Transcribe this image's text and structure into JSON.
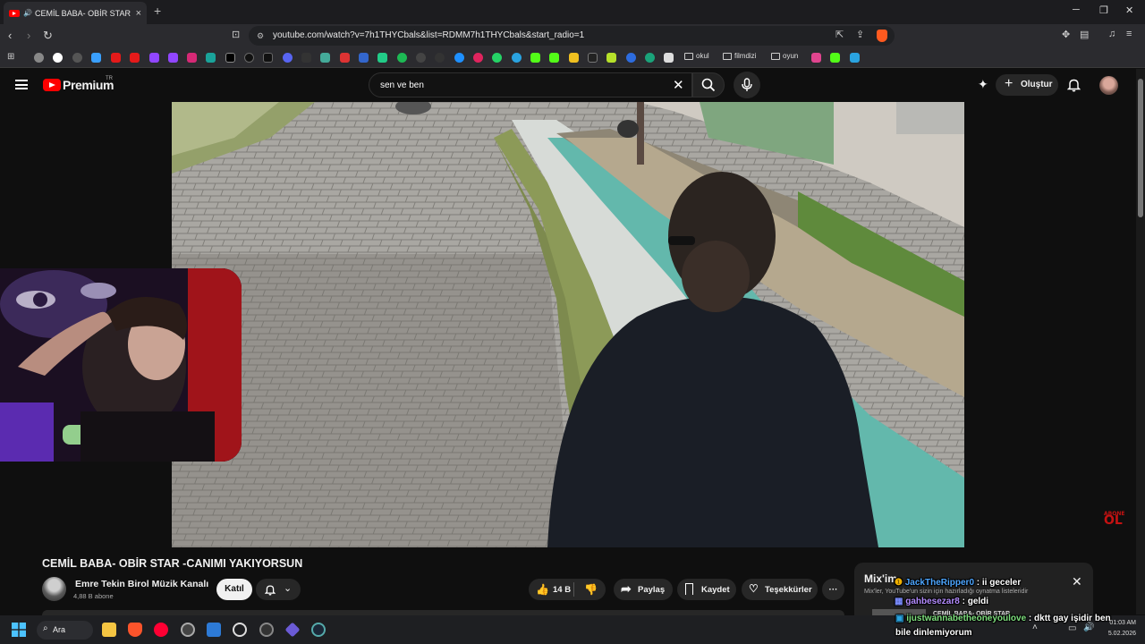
{
  "browser": {
    "tab_title": "CEMİL BABA- OBİR STAR -CA",
    "new_tab": "+",
    "minimize": "─",
    "restore": "❐",
    "close": "✕",
    "url": "youtube.com/watch?v=7h1THYCbals&list=RDMM7h1THYCbals&start_radio=1",
    "bookmark_folders": [
      "okul",
      "filmdizi",
      "oyun"
    ]
  },
  "youtube": {
    "brand": "Premium",
    "country": "TR",
    "search_value": "sen ve ben",
    "create_label": "Oluştur"
  },
  "video": {
    "title": "CEMİL BABA- OBİR STAR -CANIMI YAKIYORSUN",
    "channel_name": "Emre Tekin Birol Müzik Kanalı",
    "subscribers": "4,88 B abone",
    "join_label": "Katıl",
    "likes": "14 B",
    "share_label": "Paylaş",
    "save_label": "Kaydet",
    "thanks_label": "Teşekkürler",
    "more_label": "···",
    "watermark_top": "ABONE",
    "watermark_bottom": "OL"
  },
  "mix": {
    "title": "Mix'im",
    "subtitle": "Mix'ler, YouTube'un sizin için hazırladığı oynatma listeleridir",
    "next_item": "CEMİL BABA- OBİR STAR"
  },
  "chat": [
    {
      "user": "JackTheRipper0",
      "message": " : ii geceler"
    },
    {
      "user": "gahbesezar8",
      "message": " : geldi"
    },
    {
      "user": "ijustwannabetheoneyoulove",
      "message": " : dktt gay işidir ben",
      "continuation": "bile dinlemiyorum"
    }
  ],
  "taskbar": {
    "search_label": "Ara",
    "time": "01:03 AM",
    "date": "5.02.2026"
  },
  "colors": {
    "youtube_red": "#ff0000",
    "background": "#0f0f0f",
    "chip": "#272727"
  }
}
